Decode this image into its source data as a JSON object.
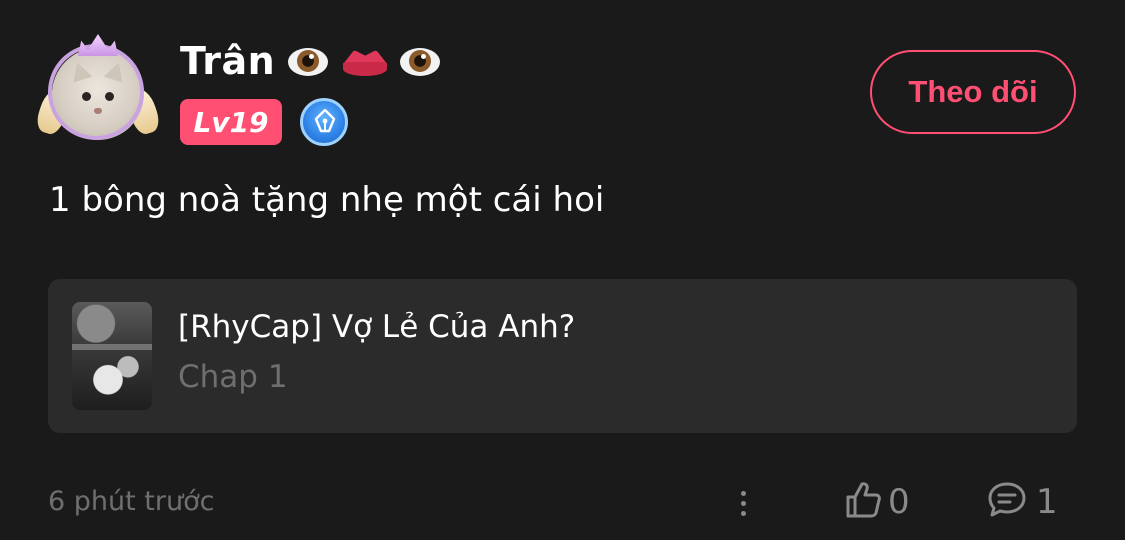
{
  "user": {
    "name": "Trân",
    "name_emojis": [
      "eye-emoji",
      "lips-emoji",
      "eye-emoji"
    ],
    "level": "Lv19",
    "level_badge_color": "#ff4f73",
    "writer_badge_icon": "pen-nib-icon"
  },
  "follow_button": {
    "label": "Theo dõi",
    "color": "#ff4f73"
  },
  "comment": {
    "text": "1 bông noà tặng nhẹ một cái hoi"
  },
  "story": {
    "title": "[RhyCap] Vợ Lẻ Của Anh?",
    "chapter": "Chap 1"
  },
  "footer": {
    "timestamp": "6 phút trước",
    "likes": "0",
    "replies": "1"
  }
}
